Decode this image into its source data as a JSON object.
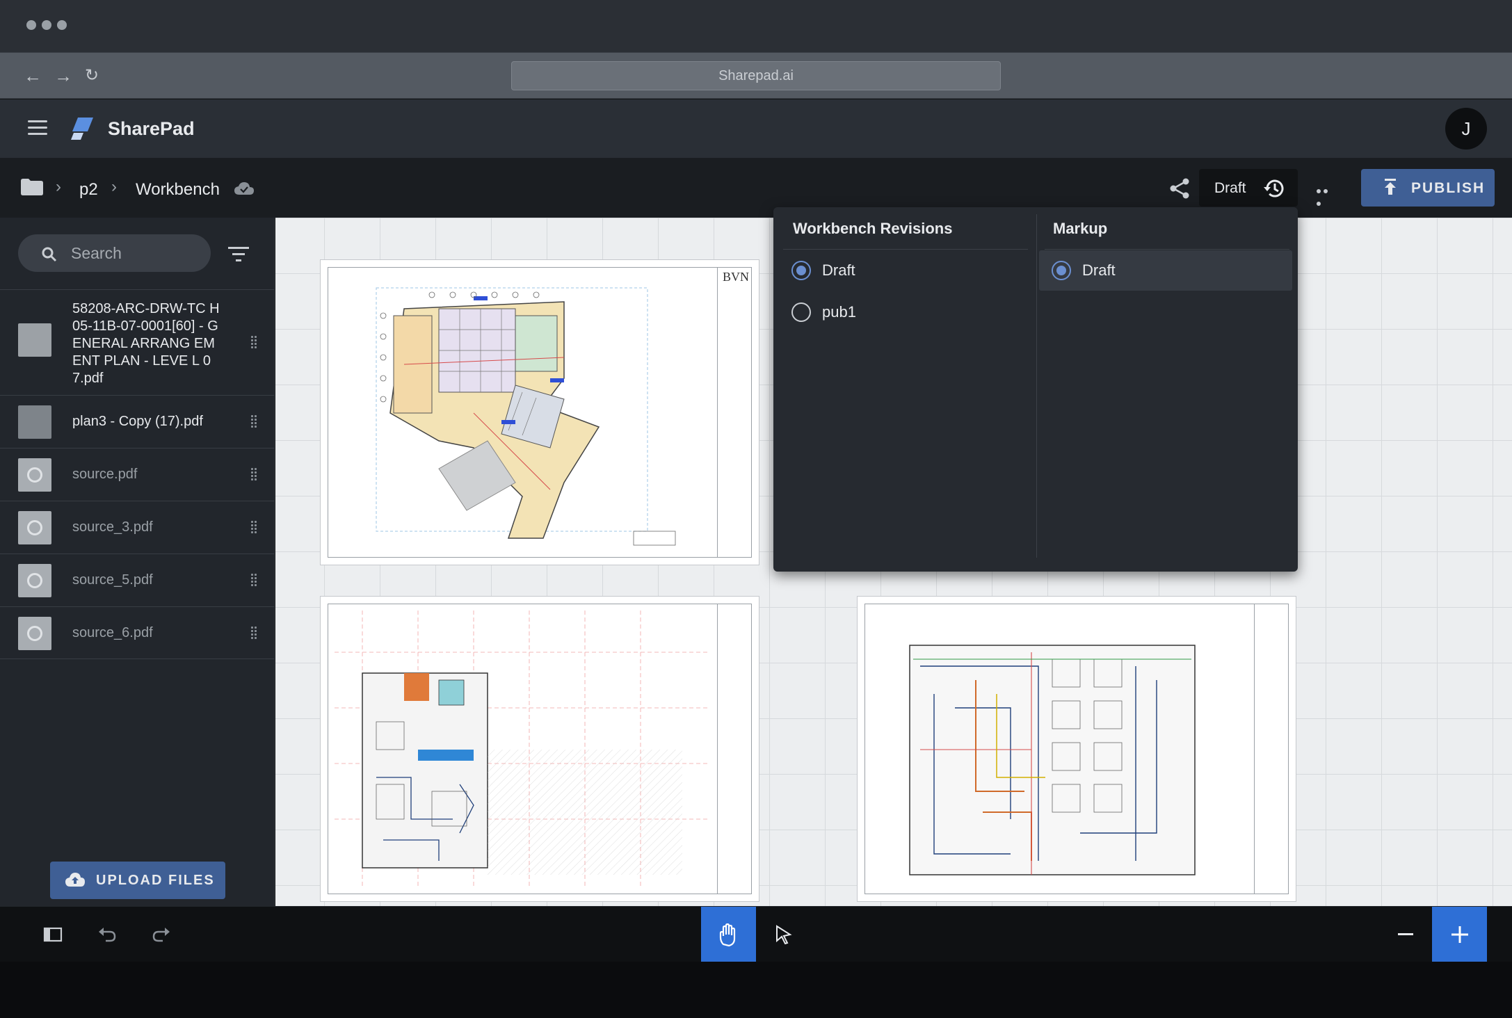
{
  "browser": {
    "url": "Sharepad.ai"
  },
  "app": {
    "name": "SharePad",
    "user_initial": "J"
  },
  "breadcrumb": {
    "project": "p2",
    "current": "Workbench"
  },
  "toolbar": {
    "revision_label": "Draft",
    "publish_label": "PUBLISH"
  },
  "sidebar": {
    "search_placeholder": "Search",
    "files": [
      {
        "name": "58208-ARC-DRW-TCH05-11B-07-0001[60] - GENERAL ARRANGEMENT PLAN - LEVEL 07.pdf",
        "display": "58208-ARC-DRW-TC H05-11B-07-0001[60] - GENERAL ARRANG EMENT PLAN - LEVE L 07.pdf"
      },
      {
        "name": "plan3 - Copy (17).pdf",
        "display": "plan3 - Copy (17).pdf"
      },
      {
        "name": "source.pdf",
        "display": "source.pdf"
      },
      {
        "name": "source_3.pdf",
        "display": "source_3.pdf"
      },
      {
        "name": "source_5.pdf",
        "display": "source_5.pdf"
      },
      {
        "name": "source_6.pdf",
        "display": "source_6.pdf"
      }
    ],
    "upload_label": "UPLOAD FILES"
  },
  "canvas": {
    "sheet_1_title_block": "BVN"
  },
  "revisions_panel": {
    "workbench_title": "Workbench Revisions",
    "workbench_options": [
      {
        "label": "Draft",
        "selected": true
      },
      {
        "label": "pub1",
        "selected": false
      }
    ],
    "markup_title": "Markup",
    "markup_options": [
      {
        "label": "Draft",
        "selected": true
      }
    ]
  },
  "colors": {
    "accent": "#2e6fd6",
    "button": "#3f5f95",
    "radio_selected": "#6b8fd0"
  }
}
